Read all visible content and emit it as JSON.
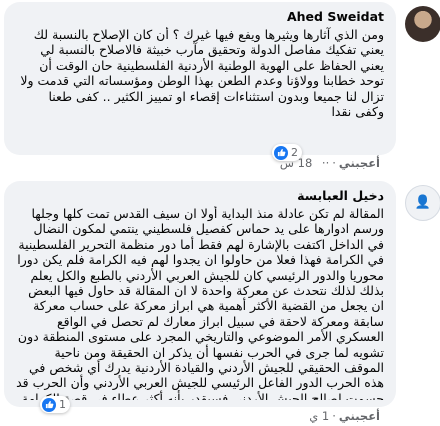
{
  "comments": [
    {
      "author": "Ahed Sweidat",
      "text": "ومن الذي آثارها ويثيرها ويفع فيها غيرك ؟ أن كان الإصلاح بالنسبة لك يعني تفكيك مفاصل الدولة وتحقيق مآرب خبيثة فالاصلاح بالنسبة لي يعني الحفاظ على الهوية الوطنية الأردنية الفلسطينية حان الوقت أن توحد خطابنا وولاؤنا وعدم الطعن بهذا الوطن ومؤسساته التي قدمت ولا تزال لنا جميعا وبدون استثناءات إقصاء او تمييز الكثير .. كفى طعنا وكفى نقدا",
      "like_label": "أعجبني",
      "time": "18 س",
      "reaction_count": "2"
    },
    {
      "author": "دخيل العبابسة",
      "text": "المقالة لم تكن عادلة منذ البداية أولا ان سيف القدس تمت كلها وجلها ورسم ادوارها على يد حماس كفصيل فلسطيني ينتمي لمكون النضال في الداخل اكتفت بالإشارة لهم فقط أما دور منظمة التحرير الفلسطينية في الكرامة فهذا فعلا من حاولوا ان يجدوا لهم فيه الكرامة فلم يكن دورا محوريا والدور الرئيسي كان للجيش العربي الأردني بالطبع والكل يعلم بذلك لذلك نتحدث عن معركة واحدة لا ان المقالة قد حاول فيها البعض ان يجعل من القضية الأكثر أهمية هي ابراز معركة على حساب معركة سابقة ومعركة لاحقة في سبيل ابراز معارك لم تحصل في الواقع العسكري الأمر الموضوعي والتاريخي المجرد على مستوى المنطقة دون تشويه لما جرى في الحرب نفسها أن يذكر ان الحقيقة ومن ناحية الموقف الحقيقي للجيش الأردني والقيادة الأردنية يدرك أي شخص في هذه الحرب الدور الفاعل الرئيسي للجيش العربي الأردني وأن الحرب قد حسمت لصالح الجيش الأردني فسيقدر بأنه أكثر عطاء في قصة الكرامة وأن المعركة لم تكن كلها كانت بيد منظمة التحرير أعتقد بأن ذكر ان المعركة كانت للجيش الأردني ومنظمة التحرير كان الأولى ولا يثير في الهدف من المقالة",
      "like_label": "أعجبني",
      "time": "1 ي",
      "reaction_count": "1"
    }
  ],
  "colors": {
    "bubble": "#f0f2f5",
    "meta_text": "#65676b",
    "like_blue": "#1877f2"
  },
  "icons": {
    "reaction": "like-thumb-icon",
    "options": "more-dots-icon"
  }
}
